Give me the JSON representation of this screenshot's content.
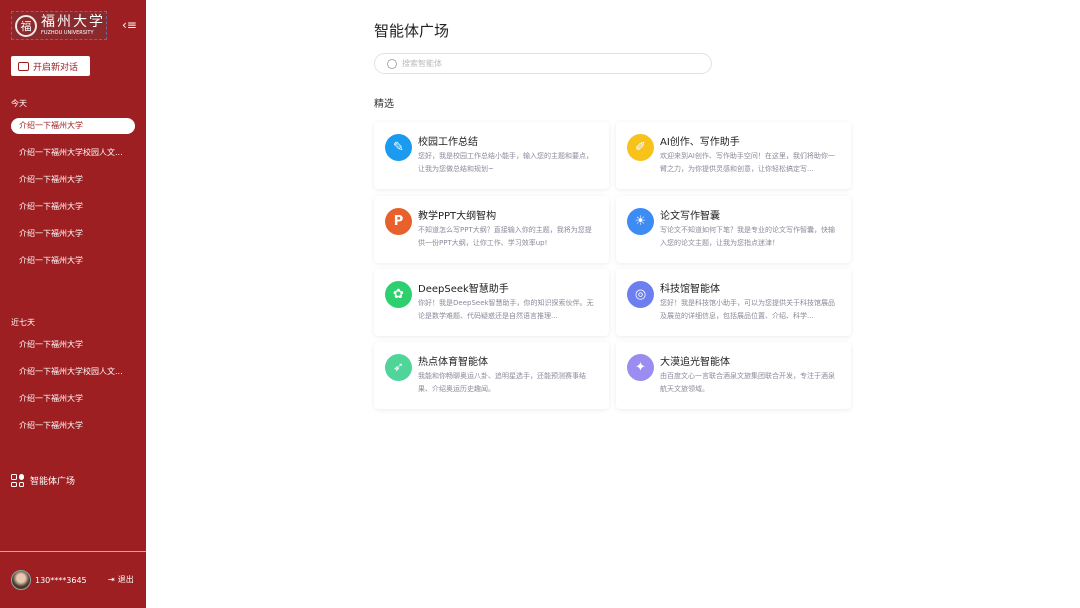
{
  "sidebar": {
    "logo_text": "福州大学",
    "logo_sub": "FUZHOU UNIVERSITY",
    "new_chat": "开启新对话",
    "today_label": "今天",
    "today": [
      "介绍一下福州大学",
      "介绍一下福州大学校园人文...",
      "介绍一下福州大学",
      "介绍一下福州大学",
      "介绍一下福州大学",
      "介绍一下福州大学"
    ],
    "week_label": "近七天",
    "week": [
      "介绍一下福州大学",
      "介绍一下福州大学校园人文...",
      "介绍一下福州大学",
      "介绍一下福州大学"
    ],
    "plaza": "智能体广场",
    "user": "130****3645",
    "logout": "退出"
  },
  "main": {
    "title": "智能体广场",
    "search_placeholder": "搜索智能体",
    "featured": "精选",
    "cards": [
      {
        "name": "校园工作总结",
        "desc": "您好，我是校园工作总结小能手，输入您的主题和要点，让我为您做总结和规划~",
        "color": "#1a9bf0"
      },
      {
        "name": "AI创作、写作助手",
        "desc": "欢迎来到AI创作、写作助手空间！在这里，我们将助你一臂之力，为你提供灵感和创意，让你轻松搞定写...",
        "color": "#f7c21a"
      },
      {
        "name": "教学PPT大纲智构",
        "desc": "不知道怎么写PPT大纲？直接输入你的主题，我将为您提供一份PPT大纲，让你工作、学习效率up!",
        "color": "#e8602c"
      },
      {
        "name": "论文写作智囊",
        "desc": "写论文不知道如何下笔？我是专业的论文写作智囊，快输入您的论文主题，让我为您指点迷津！",
        "color": "#3d8bf5"
      },
      {
        "name": "DeepSeek智慧助手",
        "desc": "你好！我是DeepSeek智慧助手，你的知识探索伙伴。无论是数学难题、代码疑惑还是自然语言推理...",
        "color": "#2ecf6e"
      },
      {
        "name": "科技馆智能体",
        "desc": "您好！我是科技馆小助手，可以为您提供关于科技馆展品及展览的详细信息，包括展品位置、介绍、科学...",
        "color": "#6b7ff0"
      },
      {
        "name": "热点体育智能体",
        "desc": "我能和你畅聊奥运八卦、追明星选手，还能预测赛事结果、介绍奥运历史趣闻。",
        "color": "#4fd49a"
      },
      {
        "name": "大漠追光智能体",
        "desc": "由百度文心一言联合酒泉文旅集团联合开发，专注于酒泉航天文旅领域。",
        "color": "#9b8cf2"
      }
    ]
  }
}
